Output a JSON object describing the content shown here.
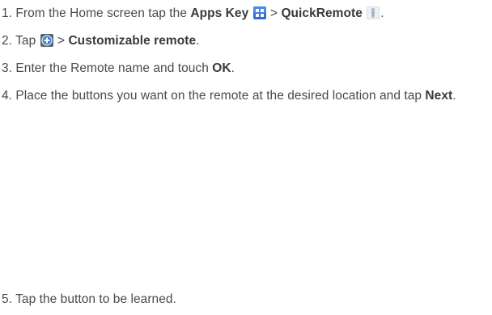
{
  "steps": [
    {
      "number": "1.",
      "text_before": "From the Home screen tap the ",
      "bold_1": "Apps Key",
      "icon_1": "apps-key-icon",
      "separator": " > ",
      "bold_2": "QuickRemote",
      "icon_2": "quickremote-app-icon",
      "text_after": "."
    },
    {
      "number": "2.",
      "text_before": "Tap ",
      "icon_1": "add-circle-icon",
      "separator": " > ",
      "bold_1": "Customizable remote",
      "text_after": "."
    },
    {
      "number": "3.",
      "text_before": "Enter the Remote name and touch ",
      "bold_1": "OK",
      "text_after": "."
    },
    {
      "number": "4.",
      "text_before": "Place the buttons you want on the remote at the desired location and tap ",
      "bold_1": "Next",
      "text_after": "."
    },
    {
      "number": "5.",
      "text": "Tap the button to be learned."
    }
  ],
  "colors": {
    "text": "#4a4a4a",
    "apps_key_blue": "#2f6fd1",
    "add_icon_blue": "#3d83d6"
  }
}
